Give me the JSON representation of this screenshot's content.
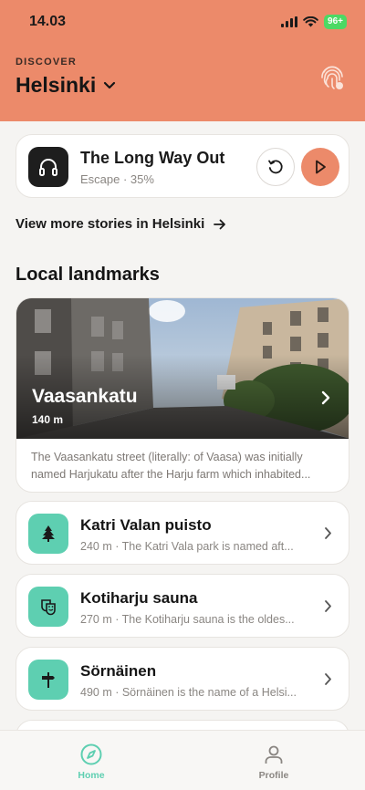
{
  "status": {
    "time": "14.03",
    "battery": "96+"
  },
  "header": {
    "eyebrow": "DISCOVER",
    "city": "Helsinki"
  },
  "player": {
    "title": "The Long Way Out",
    "subtitle": "Escape · 35%",
    "progress_percent": 35
  },
  "more_link": {
    "label": "View more stories in Helsinki"
  },
  "section": {
    "title": "Local landmarks"
  },
  "featured": {
    "name": "Vaasankatu",
    "distance": "140 m",
    "description": "The Vaasankatu street (literally: of Vaasa) was initially named Harjukatu after the Harju farm which inhabited..."
  },
  "landmarks": [
    {
      "name": "Katri Valan puisto",
      "subtitle": "240 m · The Katri Vala park is named aft...",
      "icon": "tree-icon"
    },
    {
      "name": "Kotiharju sauna",
      "subtitle": "270 m · The Kotiharju sauna is the oldes...",
      "icon": "theater-mask-icon"
    },
    {
      "name": "Sörnäinen",
      "subtitle": "490 m · Sörnäinen is the name of a Helsi...",
      "icon": "signpost-icon"
    }
  ],
  "tabs": [
    {
      "label": "Home",
      "icon": "compass-icon",
      "active": true
    },
    {
      "label": "Profile",
      "icon": "person-icon",
      "active": false
    }
  ],
  "colors": {
    "accent": "#ec8a6a",
    "landmark_icon_bg": "#5ecfb1",
    "tab_active": "#5ecfb1",
    "tab_inactive": "#8a8682"
  }
}
